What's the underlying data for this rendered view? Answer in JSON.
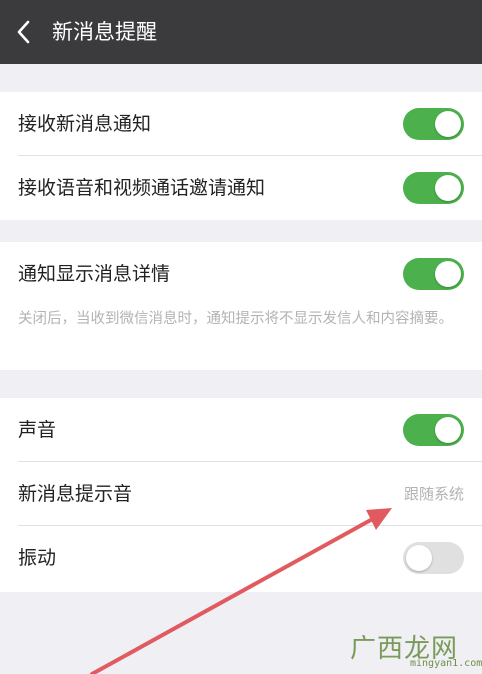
{
  "header": {
    "title": "新消息提醒"
  },
  "group1": {
    "items": [
      {
        "label": "接收新消息通知",
        "state": "on"
      },
      {
        "label": "接收语音和视频通话邀请通知",
        "state": "on"
      }
    ]
  },
  "group2": {
    "label": "通知显示消息详情",
    "state": "on",
    "hint": "关闭后，当收到微信消息时，通知提示将不显示发信人和内容摘要。"
  },
  "group3": {
    "sound": {
      "label": "声音",
      "state": "on"
    },
    "tone": {
      "label": "新消息提示音",
      "value": "跟随系统"
    },
    "vibrate": {
      "label": "振动",
      "state": "off"
    }
  },
  "watermark": {
    "text": "广西龙网",
    "url": "mingyan1.com"
  },
  "colors": {
    "header_bg": "#3b3b3d",
    "toggle_on": "#4cb14c",
    "toggle_off": "#e0e0e0",
    "arrow": "#e05a60"
  }
}
